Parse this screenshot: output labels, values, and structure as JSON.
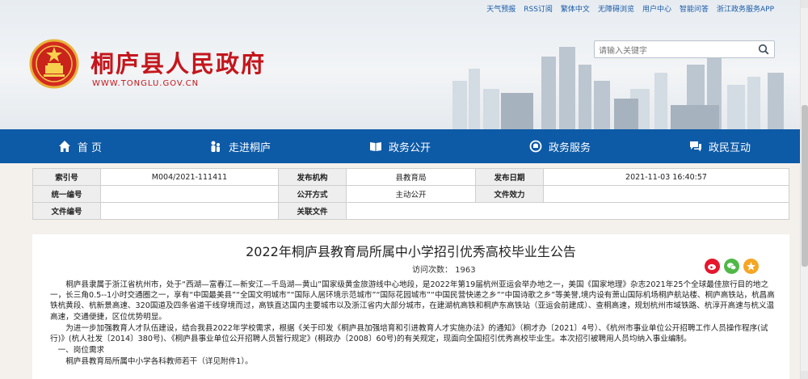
{
  "top_links": [
    "天气预报",
    "RSS订阅",
    "繁体中文",
    "无障碍浏览",
    "用户中心",
    "智能问答",
    "浙江政务服务APP"
  ],
  "header": {
    "title": "桐庐县人民政府",
    "url": "WWW.TONGLU.GOV.CN"
  },
  "search": {
    "placeholder": "请输入关键字"
  },
  "nav": [
    {
      "label": "首  页",
      "icon": "home-icon"
    },
    {
      "label": "走进桐庐",
      "icon": "people-icon"
    },
    {
      "label": "政务公开",
      "icon": "book-icon"
    },
    {
      "label": "政务服务",
      "icon": "service-icon"
    },
    {
      "label": "政民互动",
      "icon": "interaction-icon"
    }
  ],
  "meta": {
    "index_label": "索引号",
    "index_value": "M004/2021-111411",
    "publisher_label": "发布机构",
    "publisher_value": "县教育局",
    "date_label": "发布日期",
    "date_value": "2021-11-03 16:40:57",
    "code_label": "统一编号",
    "code_value": "",
    "method_label": "公开方式",
    "method_value": "主动公开",
    "validity_label": "文件效力",
    "validity_value": "",
    "docno_label": "文件编号",
    "docno_value": "",
    "keywords_label": "关联文件",
    "keywords_value": ""
  },
  "article": {
    "title": "2022年桐庐县教育局所属中小学招引优秀高校毕业生公告",
    "visits": "访问次数： 1963",
    "p1": "桐庐县隶属于浙江省杭州市，处于“西湖—富春江—新安江—千岛湖—黄山”国家级黄金旅游线中心地段，是2022年第19届杭州亚运会举办地之一，美国《国家地理》杂志2021年25个全球最佳旅行目的地之一，长三角0.5--1小时交通圈之一，享有“中国最美县”“全国文明城市”“国际人居环境示范城市”“国际花园城市”“中国民营快递之乡”“中国诗歌之乡”等美誉,境内设有萧山国际机场桐庐航站楼、桐庐高铁站，杭昌高铁杭黄段、杭新景高速、320国道及四条省道干线穿境而过，高铁直达国内主要城市以及浙江省内大部分城市，在建湖杭高铁和桐庐东高铁站（亚运会前建成）、查桐高速，规划杭州市域铁路、杭淳开高速与杭义温高速，交通便捷，区位优势明显。",
    "p2": "为进一步加强教育人才队伍建设，结合我县2022年学校需求，根据《关于印发《桐庐县加强培育和引进教育人才实施办法》的通知》（桐才办〔2021〕4号）、《杭州市事业单位公开招聘工作人员操作程序(试行)》(杭人社发〔2014〕380号)、《桐庐县事业单位公开招聘人员暂行规定》(桐政办〔2008〕60号)的有关规定，现面向全国招引优秀高校毕业生。本次招引被聘用人员均纳入事业编制。",
    "p3": "一、岗位需求",
    "p4": "桐庐县教育局所属中小学各科教师若干（详见附件1）。"
  },
  "colors": {
    "nav": "#0d5aa7",
    "title_red": "#c4161c",
    "weibo": "#e6162d",
    "wechat": "#51b848",
    "star": "#f5a623"
  }
}
